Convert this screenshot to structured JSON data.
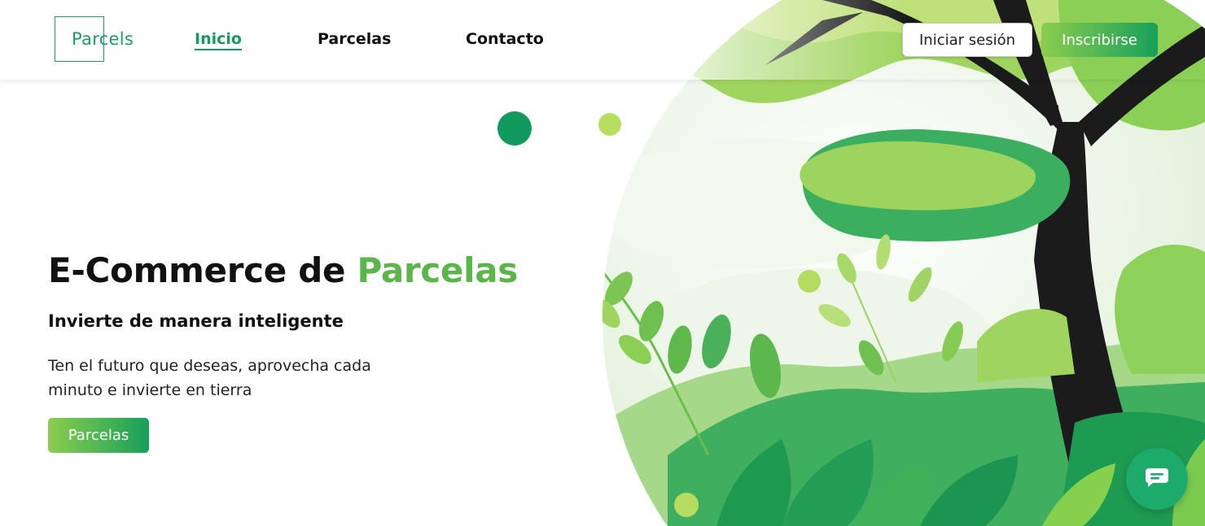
{
  "brand": {
    "logo_text": "Parcels",
    "color_primary": "#1aa067"
  },
  "nav": {
    "items": [
      {
        "label": "Inicio",
        "active": true
      },
      {
        "label": "Parcelas",
        "active": false
      },
      {
        "label": "Contacto",
        "active": false
      }
    ]
  },
  "auth": {
    "login_label": "Iniciar sesión",
    "signup_label": "Inscribirse"
  },
  "hero": {
    "title_main": "E-Commerce de ",
    "title_accent": "Parcelas",
    "subtitle": "Invierte de manera inteligente",
    "description": "Ten el futuro que deseas, aprovecha cada minuto e invierte en tierra",
    "cta_label": "Parcelas"
  },
  "chat": {
    "icon": "chat-icon"
  },
  "colors": {
    "accent_green": "#5bb54a",
    "gradient_start": "#8ccd4f",
    "gradient_end": "#17a05a",
    "chat_green": "#1cab6b",
    "tree_trunk": "#1b1b1b"
  }
}
